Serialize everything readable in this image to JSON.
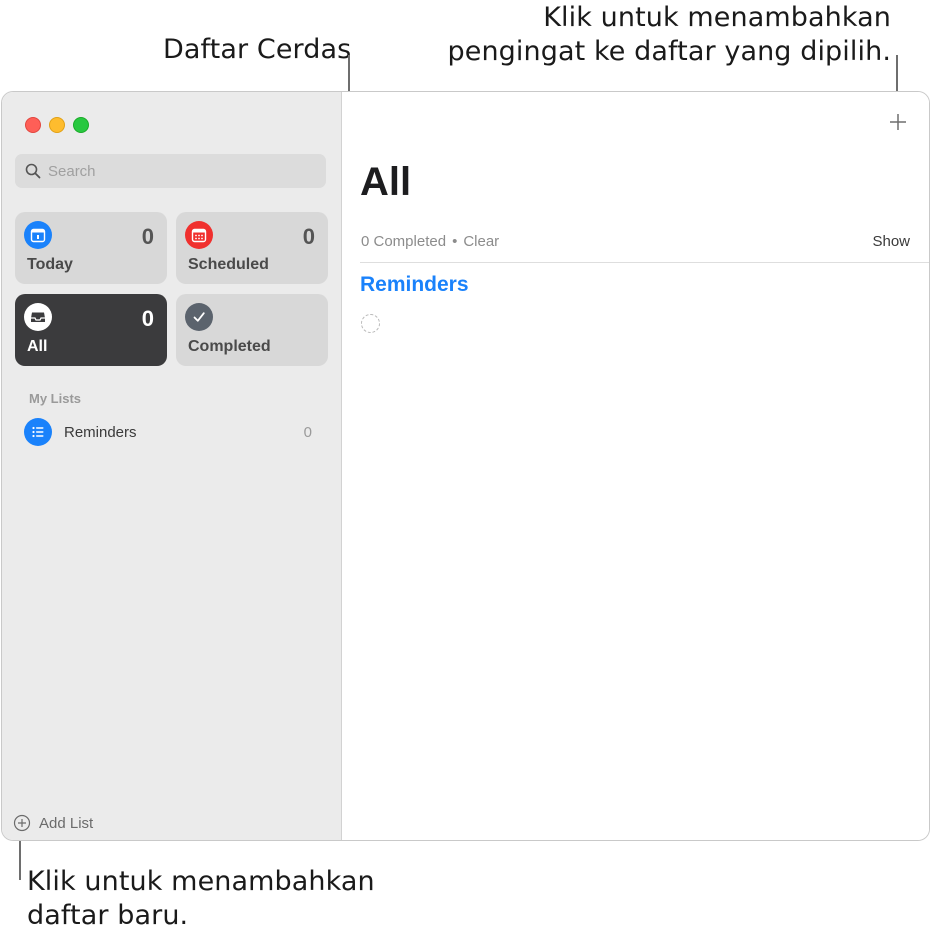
{
  "annotations": {
    "smart_lists": "Daftar Cerdas",
    "add_reminder": [
      "Klik untuk menambahkan",
      "pengingat ke daftar yang dipilih."
    ],
    "add_list": [
      "Klik untuk menambahkan",
      "daftar baru."
    ]
  },
  "sidebar": {
    "search_placeholder": "Search",
    "smart_lists": [
      {
        "label": "Today",
        "count": "0",
        "icon": "calendar-today-icon",
        "color": "#1a82fb"
      },
      {
        "label": "Scheduled",
        "count": "0",
        "icon": "calendar-grid-icon",
        "color": "#f0302e"
      },
      {
        "label": "All",
        "count": "0",
        "icon": "tray-icon",
        "color": "#3b3b3d",
        "selected": true
      },
      {
        "label": "Completed",
        "count": "",
        "icon": "checkmark-icon",
        "color": "#5b636d"
      }
    ],
    "section_title": "My Lists",
    "lists": [
      {
        "name": "Reminders",
        "count": "0",
        "icon": "list-bullet-icon",
        "color": "#1a82fb"
      }
    ],
    "add_list_label": "Add List"
  },
  "main": {
    "title": "All",
    "completed_text": "0 Completed",
    "separator": "•",
    "clear_label": "Clear",
    "show_label": "Show",
    "group_title": "Reminders"
  }
}
